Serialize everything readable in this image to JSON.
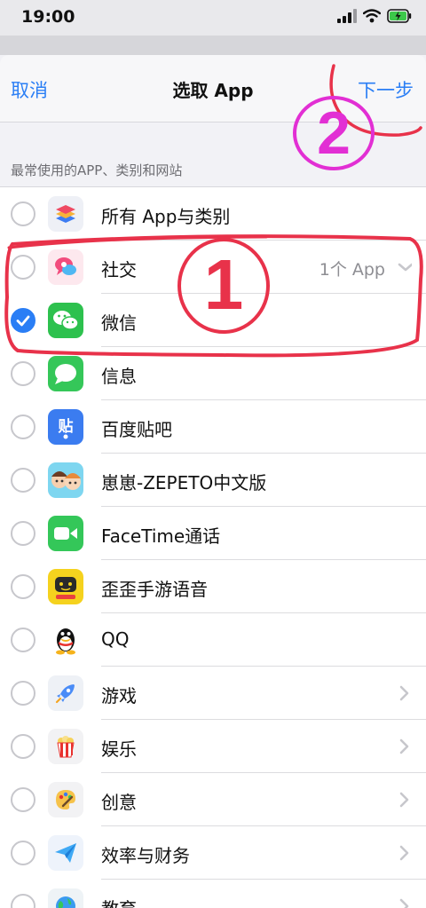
{
  "status_bar": {
    "time": "19:00"
  },
  "nav": {
    "cancel": "取消",
    "title": "选取 App",
    "next": "下一步"
  },
  "section_header": "最常使用的APP、类别和网站",
  "rows": [
    {
      "label": "所有 App与类别",
      "detail": "",
      "checked": false,
      "icon": "layers-icon",
      "accessory": "none"
    },
    {
      "label": "社交",
      "detail": "1个 App",
      "checked": false,
      "icon": "social-chat-icon",
      "accessory": "chevron-down"
    },
    {
      "label": "微信",
      "detail": "",
      "checked": true,
      "icon": "wechat-icon",
      "accessory": "none"
    },
    {
      "label": "信息",
      "detail": "",
      "checked": false,
      "icon": "messages-icon",
      "accessory": "none"
    },
    {
      "label": "百度贴吧",
      "detail": "",
      "checked": false,
      "icon": "baidu-tieba-icon",
      "accessory": "none"
    },
    {
      "label": "崽崽-ZEPETO中文版",
      "detail": "",
      "checked": false,
      "icon": "zepeto-icon",
      "accessory": "none"
    },
    {
      "label": "FaceTime通话",
      "detail": "",
      "checked": false,
      "icon": "facetime-icon",
      "accessory": "none"
    },
    {
      "label": "歪歪手游语音",
      "detail": "",
      "checked": false,
      "icon": "waiwai-game-voice-icon",
      "accessory": "none"
    },
    {
      "label": "QQ",
      "detail": "",
      "checked": false,
      "icon": "qq-penguin-icon",
      "accessory": "none"
    },
    {
      "label": "游戏",
      "detail": "",
      "checked": false,
      "icon": "games-rocket-icon",
      "accessory": "chevron-right"
    },
    {
      "label": "娱乐",
      "detail": "",
      "checked": false,
      "icon": "entertainment-popcorn-icon",
      "accessory": "chevron-right"
    },
    {
      "label": "创意",
      "detail": "",
      "checked": false,
      "icon": "creativity-palette-icon",
      "accessory": "chevron-right"
    },
    {
      "label": "效率与财务",
      "detail": "",
      "checked": false,
      "icon": "productivity-plane-icon",
      "accessory": "chevron-right"
    },
    {
      "label": "教育",
      "detail": "",
      "checked": false,
      "icon": "education-globe-icon",
      "accessory": "chevron-right"
    }
  ],
  "annotations": {
    "step1": "1",
    "step2": "2"
  },
  "colors": {
    "accent": "#2a7ef5",
    "annotation_red": "#e8324a",
    "annotation_magenta": "#e22fd4"
  }
}
